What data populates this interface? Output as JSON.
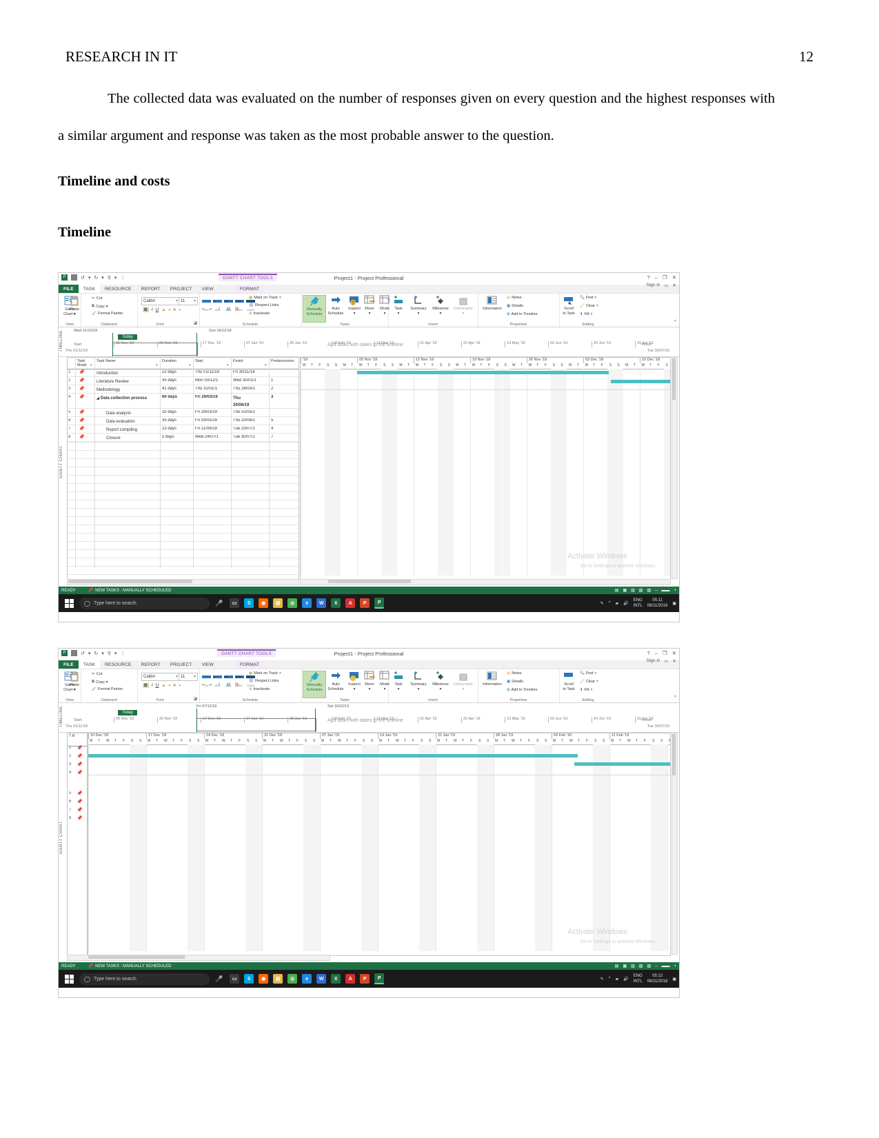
{
  "document": {
    "running_head": "RESEARCH IN IT",
    "page_number": "12",
    "paragraph1": "The collected data was evaluated on the number of responses given on every question and the highest responses with a similar argument and response was taken as the most probable answer to the question.",
    "heading1": "Timeline and costs",
    "heading2": "Timeline"
  },
  "app": {
    "title": "Project1 - Project Professional",
    "context_tab": "GANTT CHART TOOLS",
    "sign_in": "Sign in",
    "help_icon": "?",
    "minimize_icon": "–",
    "restore_icon": "❐",
    "close_icon": "✕",
    "qat": {
      "app_icon": "P",
      "save_icon": "save-icon",
      "undo_icon": "↺",
      "redo_icon": "↻",
      "link_icon": "⚲",
      "more_icon": "▾"
    },
    "tabs": [
      "FILE",
      "TASK",
      "RESOURCE",
      "REPORT",
      "PROJECT",
      "VIEW",
      "FORMAT"
    ],
    "ribbon": {
      "groups": [
        "View",
        "Clipboard",
        "Font",
        "Schedule",
        "Tasks",
        "Insert",
        "Properties",
        "Editing"
      ],
      "view": {
        "label1": "Gantt",
        "label2": "Chart"
      },
      "clipboard": {
        "paste": "Paste",
        "cut": "Cut",
        "copy": "Copy",
        "format_painter": "Format Painter"
      },
      "font": {
        "family": "Calibri",
        "size": "11",
        "bold": "B",
        "italic": "I",
        "underline": "U",
        "highlight": "A",
        "color": "A"
      },
      "schedule": {
        "pct0": "0%",
        "pct25": "25%",
        "pct50": "50%",
        "pct75": "75%",
        "pct100": "100%",
        "mark_on_track": "Mark on Track",
        "respect_links": "Respect Links",
        "inactivate": "Inactivate"
      },
      "tasks": {
        "manually": "Manually",
        "manually2": "Schedule",
        "auto": "Auto",
        "auto2": "Schedule",
        "inspect": "Inspect",
        "move": "Move",
        "mode": "Mode"
      },
      "insert": {
        "task": "Task",
        "summary": "Summary",
        "milestone": "Milestone",
        "deliverable": "Deliverable"
      },
      "properties": {
        "information": "Information",
        "notes": "Notes",
        "details": "Details",
        "add_to_timeline": "Add to Timeline"
      },
      "editing": {
        "scroll": "Scroll",
        "to_task": "to Task",
        "find": "Find",
        "clear": "Clear",
        "fill": "Fill"
      }
    }
  },
  "screenshot1": {
    "timeline": {
      "section_label": "TIMELINE",
      "start_date_top": "Wed 31/10/18",
      "finish_date_top": "Sun 16/12/18",
      "today_label": "Today",
      "start_label": "Start",
      "start_value": "Thu 01/11/18",
      "finish_label": "Finish",
      "finish_value": "Tue 30/07/19",
      "placeholder": "Add tasks with dates to the timeline",
      "ticks": [
        "05 Nov '18",
        "26 Nov '18",
        "17 Dec '18",
        "07 Jan '19",
        "28 Jan '19",
        "18 Feb '19",
        "11 Mar '19",
        "01 Apr '19",
        "22 Apr '19",
        "13 May '19",
        "03 Jun '19",
        "24 Jun '19",
        "15 Jul '19"
      ]
    },
    "gantt": {
      "section_label": "GANTT CHART",
      "columns": [
        "Task Mode",
        "Task Name",
        "Duration",
        "Start",
        "Finish",
        "Predecessors"
      ],
      "rows": [
        {
          "id": "1",
          "mode": "manual",
          "name": "Introduction",
          "indent": 1,
          "duration": "22 days",
          "start": "Thu 01/11/18",
          "finish": "Fri 30/11/18",
          "pred": ""
        },
        {
          "id": "2",
          "mode": "manual",
          "name": "Literature Review",
          "indent": 1,
          "duration": "43 days",
          "start": "Mon 03/12/1",
          "finish": "Wed 30/01/1",
          "pred": "1"
        },
        {
          "id": "3",
          "mode": "manual",
          "name": "Methodology",
          "indent": 1,
          "duration": "41 days",
          "start": "Thu 31/01/1",
          "finish": "Thu 28/03/1",
          "pred": "2"
        },
        {
          "id": "4",
          "mode": "manual",
          "name": "Data collection process",
          "indent": 1,
          "duration": "60 days",
          "start": "Fri 29/03/19",
          "finish": "Thu 20/06/19",
          "pred": "3",
          "summary": true
        },
        {
          "id": "5",
          "mode": "manual",
          "name": "Data analysis",
          "indent": 2,
          "duration": "25 days",
          "start": "Fri 29/03/19",
          "finish": "Thu 02/05/1",
          "pred": ""
        },
        {
          "id": "6",
          "mode": "manual",
          "name": "Data evaluation",
          "indent": 2,
          "duration": "35 days",
          "start": "Fri 03/05/19",
          "finish": "Thu 20/06/1",
          "pred": "5"
        },
        {
          "id": "7",
          "mode": "manual",
          "name": "Report compiling",
          "indent": 2,
          "duration": "23 days",
          "start": "Fri 21/06/19",
          "finish": "Tue 23/07/1",
          "pred": "4"
        },
        {
          "id": "8",
          "mode": "manual",
          "name": "Closure",
          "indent": 2,
          "duration": "5 days",
          "start": "Wed 24/07/1",
          "finish": "Tue 30/07/1",
          "pred": "7"
        }
      ],
      "timescale_weeks": [
        "'18",
        "05 Nov '18",
        "12 Nov '18",
        "19 Nov '18",
        "26 Nov '18",
        "03 Dec '18",
        "10 Dec '18"
      ],
      "day_letters": [
        "W",
        "T",
        "F",
        "S",
        "S",
        "M",
        "T",
        "W",
        "T",
        "F",
        "S",
        "S",
        "M",
        "T",
        "W",
        "T",
        "F",
        "S",
        "S",
        "M",
        "T",
        "W",
        "T",
        "F",
        "S",
        "S",
        "M",
        "T",
        "W",
        "T",
        "F",
        "S",
        "S",
        "M",
        "T",
        "W",
        "T",
        "F",
        "S",
        "S",
        "M",
        "T",
        "W",
        "T",
        "F",
        "S"
      ]
    },
    "statusbar": {
      "ready": "READY",
      "new_tasks": "NEW TASKS : MANUALLY SCHEDULED",
      "zoom_out": "–",
      "zoom_in": "+"
    },
    "watermark": {
      "line1": "Activate Windows",
      "line2": "Go to Settings to activate Windows."
    },
    "taskbar": {
      "search_placeholder": "Type here to search",
      "clock_time": "05:11",
      "clock_date": "06/11/2018",
      "lang1": "ENG",
      "lang2": "INTL"
    }
  },
  "screenshot2": {
    "timeline": {
      "section_label": "TIMELINE",
      "start_date_top": "Fri 07/12/18",
      "finish_date_top": "Sat 16/02/19",
      "today_label": "Today",
      "start_label": "Start",
      "start_value": "Thu 01/11/18",
      "finish_label": "Finish",
      "finish_value": "Tue 30/07/19",
      "placeholder": "Add tasks with dates to the timeline",
      "ticks": [
        "05 Nov '18",
        "26 Nov '18",
        "17 Dec '18",
        "07 Jan '19",
        "28 Jan '19",
        "18 Feb '19",
        "11 Mar '19",
        "01 Apr '19",
        "22 Apr '19",
        "13 May '19",
        "03 Jun '19",
        "24 Jun '19",
        "15 Jul '19"
      ]
    },
    "gantt": {
      "section_label": "GANTT CHART",
      "row_ids": [
        "1",
        "2",
        "3",
        "4",
        "5",
        "6",
        "7",
        "8"
      ],
      "timescale_weeks": [
        "10 Dec '18",
        "17 Dec '18",
        "24 Dec '18",
        "31 Dec '18",
        "07 Jan '19",
        "14 Jan '19",
        "21 Jan '19",
        "28 Jan '19",
        "04 Feb '19",
        "11 Feb '19"
      ],
      "header_label": "T M"
    },
    "statusbar": {
      "ready": "READY",
      "new_tasks": "NEW TASKS : MANUALLY SCHEDULED"
    },
    "watermark": {
      "line1": "Activate Windows",
      "line2": "Go to Settings to activate Windows."
    },
    "taskbar": {
      "search_placeholder": "Type here to search",
      "clock_time": "05:12",
      "clock_date": "06/11/2018",
      "lang1": "ENG",
      "lang2": "INTL"
    }
  },
  "colors": {
    "accent_green": "#1e7145",
    "gantt_bar": "#4bbfc3",
    "context_purple": "#8a4fb5"
  }
}
